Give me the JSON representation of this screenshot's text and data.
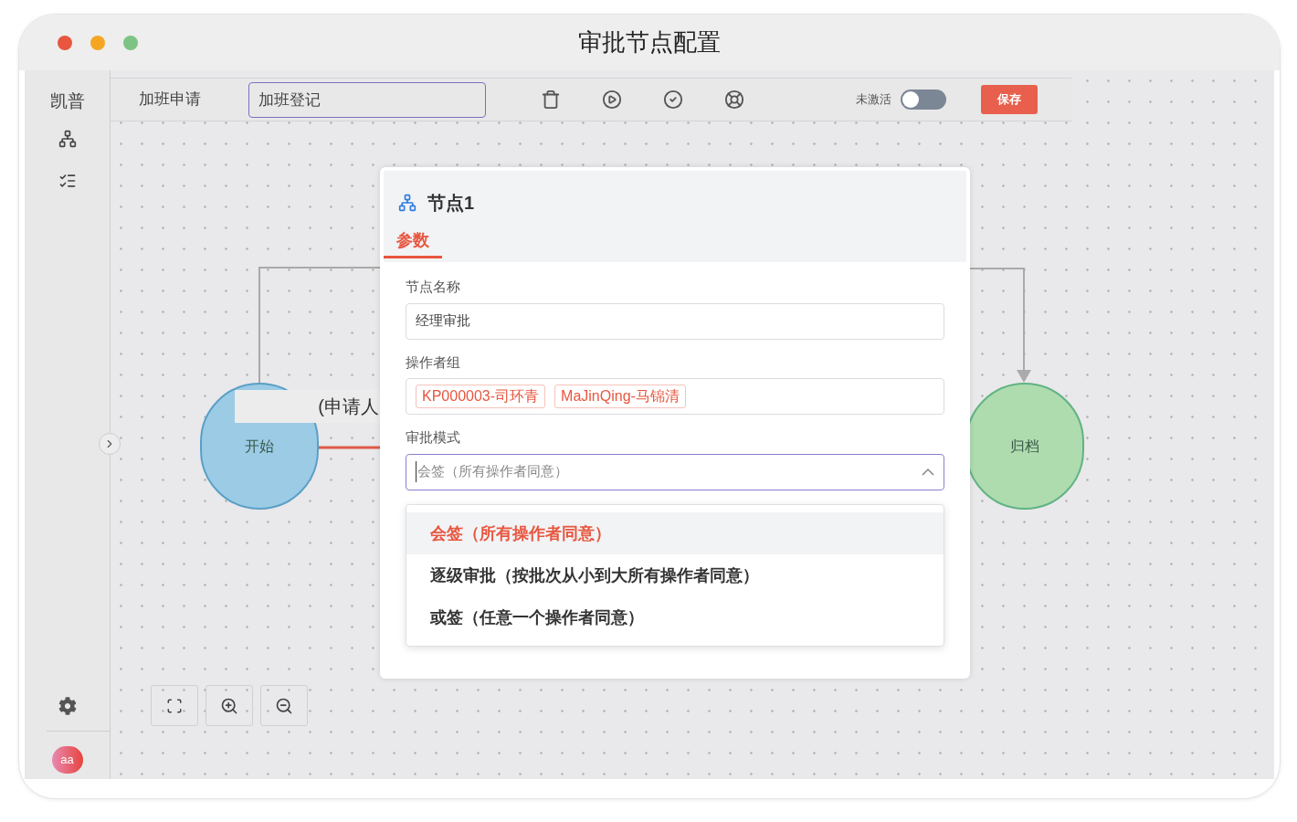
{
  "window": {
    "title": "审批节点配置"
  },
  "sidebar": {
    "brand": "凯普",
    "avatar": "aa"
  },
  "toolbar": {
    "process_name": "加班申请",
    "name_input": {
      "value": "加班登记"
    },
    "status_label": "未激活",
    "active": false,
    "save": "保存"
  },
  "canvas": {
    "nodes": [
      {
        "kind": "start",
        "label": "开始"
      },
      {
        "kind": "end",
        "label": "归档"
      }
    ],
    "edge_label": "(申请人"
  },
  "panel": {
    "title": "节点1",
    "tabs": [
      {
        "label": "参数",
        "selected": true
      }
    ],
    "fields": [
      {
        "kind": "text",
        "label": "节点名称",
        "value": "经理审批"
      },
      {
        "kind": "tags",
        "label": "操作者组",
        "tags": [
          "KP000003-司环青",
          "MaJinQing-马锦清"
        ]
      },
      {
        "kind": "select",
        "label": "审批模式",
        "placeholder": "会签（所有操作者同意）",
        "expanded": true,
        "options": [
          {
            "label": "会签（所有操作者同意）",
            "selected": true
          },
          {
            "label": "逐级审批（按批次从小到大所有操作者同意）",
            "selected": false
          },
          {
            "label": "或签（任意一个操作者同意）",
            "selected": false
          }
        ]
      }
    ]
  }
}
